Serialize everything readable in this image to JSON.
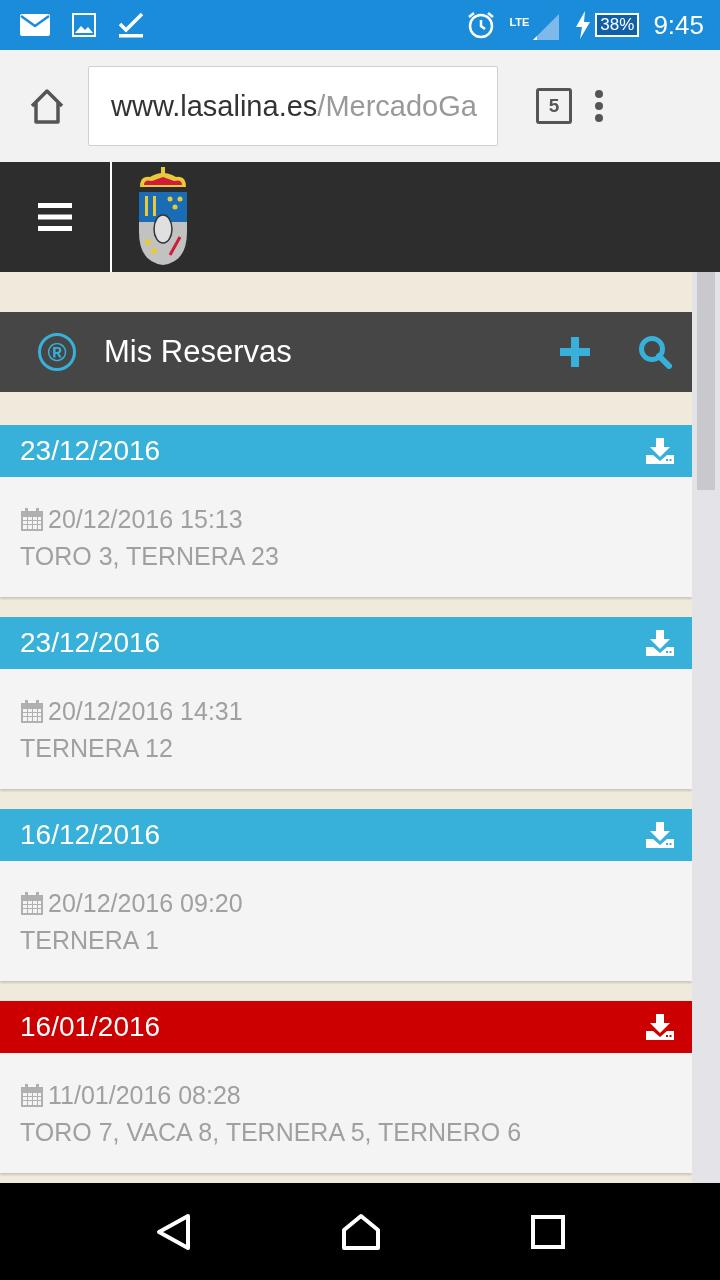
{
  "status_bar": {
    "battery": "38%",
    "network": "LTE",
    "time": "9:45"
  },
  "browser": {
    "url_host": "www.lasalina.es",
    "url_path": "/MercadoGa",
    "tab_count": "5"
  },
  "page": {
    "title": "Mis Reservas",
    "title_icon": "®"
  },
  "reservations": [
    {
      "date": "23/12/2016",
      "color": "#37b1da",
      "created": "20/12/2016 15:13",
      "items": "TORO 3, TERNERA 23"
    },
    {
      "date": "23/12/2016",
      "color": "#37b1da",
      "created": "20/12/2016 14:31",
      "items": "TERNERA 12"
    },
    {
      "date": "16/12/2016",
      "color": "#37b1da",
      "created": "20/12/2016 09:20",
      "items": "TERNERA 1"
    },
    {
      "date": "16/01/2016",
      "color": "#cc0000",
      "created": "11/01/2016 08:28",
      "items": "TORO 7, VACA 8, TERNERA 5, TERNERO 6"
    }
  ]
}
